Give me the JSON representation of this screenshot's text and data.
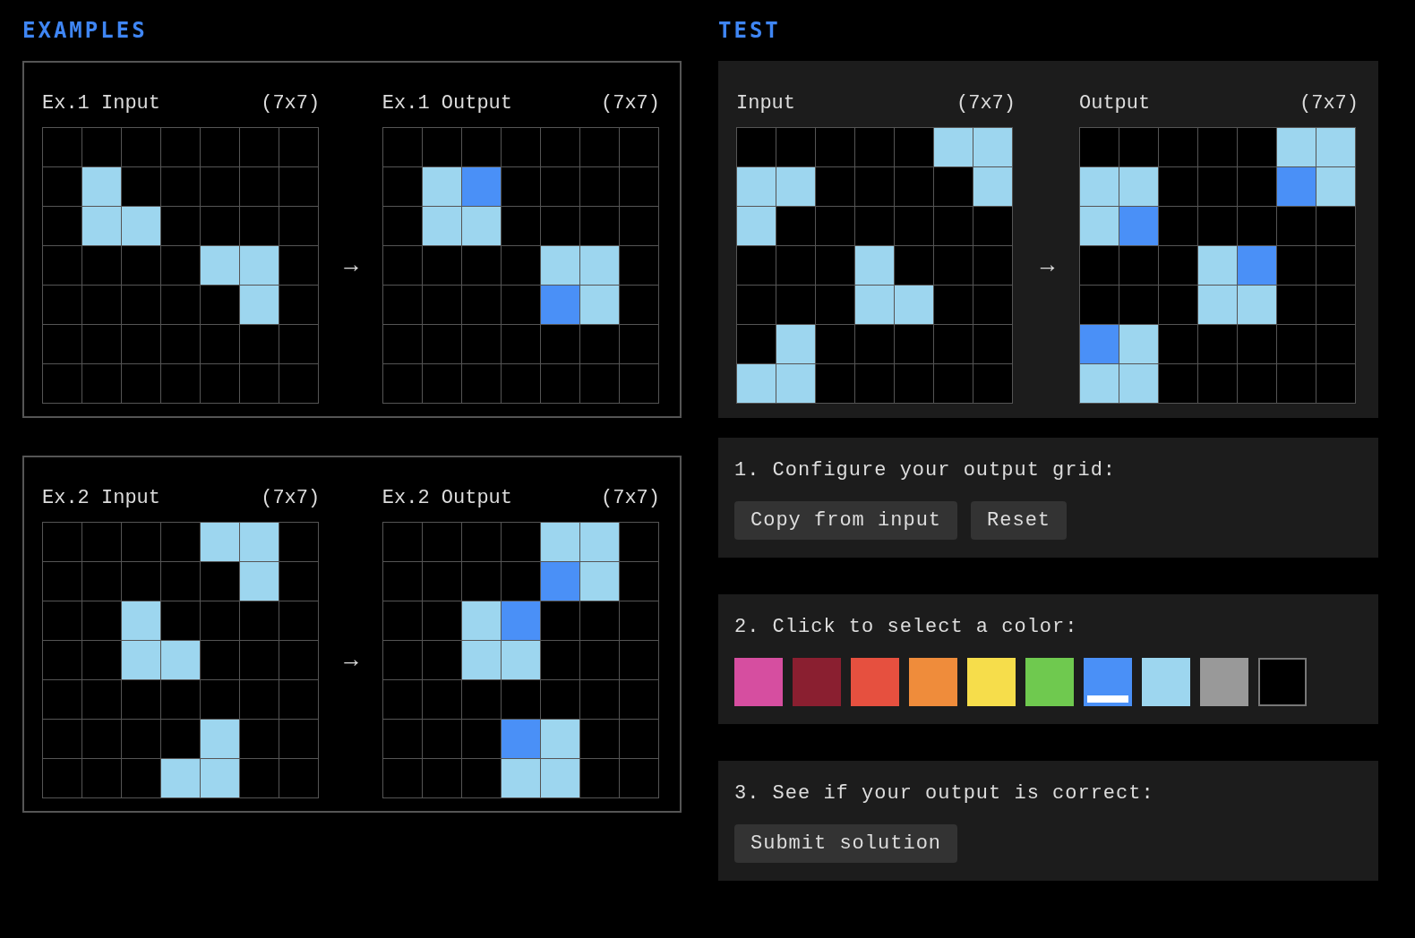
{
  "examples": {
    "heading": "EXAMPLES",
    "items": [
      {
        "input": {
          "label": "Ex.1 Input",
          "size": "(7x7)",
          "rows": [
            [
              {
                "color": "#000000"
              },
              {
                "color": "#000000"
              },
              {
                "color": "#000000"
              },
              {
                "color": "#000000"
              },
              {
                "color": "#000000"
              },
              {
                "color": "#000000"
              },
              {
                "color": "#000000"
              }
            ],
            [
              {
                "color": "#000000"
              },
              {
                "color": "#9dd6ef"
              },
              {
                "color": "#000000"
              },
              {
                "color": "#000000"
              },
              {
                "color": "#000000"
              },
              {
                "color": "#000000"
              },
              {
                "color": "#000000"
              }
            ],
            [
              {
                "color": "#000000"
              },
              {
                "color": "#9dd6ef"
              },
              {
                "color": "#9dd6ef"
              },
              {
                "color": "#000000"
              },
              {
                "color": "#000000"
              },
              {
                "color": "#000000"
              },
              {
                "color": "#000000"
              }
            ],
            [
              {
                "color": "#000000"
              },
              {
                "color": "#000000"
              },
              {
                "color": "#000000"
              },
              {
                "color": "#000000"
              },
              {
                "color": "#9dd6ef"
              },
              {
                "color": "#9dd6ef"
              },
              {
                "color": "#000000"
              }
            ],
            [
              {
                "color": "#000000"
              },
              {
                "color": "#000000"
              },
              {
                "color": "#000000"
              },
              {
                "color": "#000000"
              },
              {
                "color": "#000000"
              },
              {
                "color": "#9dd6ef"
              },
              {
                "color": "#000000"
              }
            ],
            [
              {
                "color": "#000000"
              },
              {
                "color": "#000000"
              },
              {
                "color": "#000000"
              },
              {
                "color": "#000000"
              },
              {
                "color": "#000000"
              },
              {
                "color": "#000000"
              },
              {
                "color": "#000000"
              }
            ],
            [
              {
                "color": "#000000"
              },
              {
                "color": "#000000"
              },
              {
                "color": "#000000"
              },
              {
                "color": "#000000"
              },
              {
                "color": "#000000"
              },
              {
                "color": "#000000"
              },
              {
                "color": "#000000"
              }
            ]
          ]
        },
        "arrow": "→",
        "output": {
          "label": "Ex.1 Output",
          "size": "(7x7)",
          "rows": [
            [
              {
                "color": "#000000"
              },
              {
                "color": "#000000"
              },
              {
                "color": "#000000"
              },
              {
                "color": "#000000"
              },
              {
                "color": "#000000"
              },
              {
                "color": "#000000"
              },
              {
                "color": "#000000"
              }
            ],
            [
              {
                "color": "#000000"
              },
              {
                "color": "#9dd6ef"
              },
              {
                "color": "#4a90f7"
              },
              {
                "color": "#000000"
              },
              {
                "color": "#000000"
              },
              {
                "color": "#000000"
              },
              {
                "color": "#000000"
              }
            ],
            [
              {
                "color": "#000000"
              },
              {
                "color": "#9dd6ef"
              },
              {
                "color": "#9dd6ef"
              },
              {
                "color": "#000000"
              },
              {
                "color": "#000000"
              },
              {
                "color": "#000000"
              },
              {
                "color": "#000000"
              }
            ],
            [
              {
                "color": "#000000"
              },
              {
                "color": "#000000"
              },
              {
                "color": "#000000"
              },
              {
                "color": "#000000"
              },
              {
                "color": "#9dd6ef"
              },
              {
                "color": "#9dd6ef"
              },
              {
                "color": "#000000"
              }
            ],
            [
              {
                "color": "#000000"
              },
              {
                "color": "#000000"
              },
              {
                "color": "#000000"
              },
              {
                "color": "#000000"
              },
              {
                "color": "#4a90f7"
              },
              {
                "color": "#9dd6ef"
              },
              {
                "color": "#000000"
              }
            ],
            [
              {
                "color": "#000000"
              },
              {
                "color": "#000000"
              },
              {
                "color": "#000000"
              },
              {
                "color": "#000000"
              },
              {
                "color": "#000000"
              },
              {
                "color": "#000000"
              },
              {
                "color": "#000000"
              }
            ],
            [
              {
                "color": "#000000"
              },
              {
                "color": "#000000"
              },
              {
                "color": "#000000"
              },
              {
                "color": "#000000"
              },
              {
                "color": "#000000"
              },
              {
                "color": "#000000"
              },
              {
                "color": "#000000"
              }
            ]
          ]
        }
      },
      {
        "input": {
          "label": "Ex.2 Input",
          "size": "(7x7)",
          "rows": [
            [
              {
                "color": "#000000"
              },
              {
                "color": "#000000"
              },
              {
                "color": "#000000"
              },
              {
                "color": "#000000"
              },
              {
                "color": "#9dd6ef"
              },
              {
                "color": "#9dd6ef"
              },
              {
                "color": "#000000"
              }
            ],
            [
              {
                "color": "#000000"
              },
              {
                "color": "#000000"
              },
              {
                "color": "#000000"
              },
              {
                "color": "#000000"
              },
              {
                "color": "#000000"
              },
              {
                "color": "#9dd6ef"
              },
              {
                "color": "#000000"
              }
            ],
            [
              {
                "color": "#000000"
              },
              {
                "color": "#000000"
              },
              {
                "color": "#9dd6ef"
              },
              {
                "color": "#000000"
              },
              {
                "color": "#000000"
              },
              {
                "color": "#000000"
              },
              {
                "color": "#000000"
              }
            ],
            [
              {
                "color": "#000000"
              },
              {
                "color": "#000000"
              },
              {
                "color": "#9dd6ef"
              },
              {
                "color": "#9dd6ef"
              },
              {
                "color": "#000000"
              },
              {
                "color": "#000000"
              },
              {
                "color": "#000000"
              }
            ],
            [
              {
                "color": "#000000"
              },
              {
                "color": "#000000"
              },
              {
                "color": "#000000"
              },
              {
                "color": "#000000"
              },
              {
                "color": "#000000"
              },
              {
                "color": "#000000"
              },
              {
                "color": "#000000"
              }
            ],
            [
              {
                "color": "#000000"
              },
              {
                "color": "#000000"
              },
              {
                "color": "#000000"
              },
              {
                "color": "#000000"
              },
              {
                "color": "#9dd6ef"
              },
              {
                "color": "#000000"
              },
              {
                "color": "#000000"
              }
            ],
            [
              {
                "color": "#000000"
              },
              {
                "color": "#000000"
              },
              {
                "color": "#000000"
              },
              {
                "color": "#9dd6ef"
              },
              {
                "color": "#9dd6ef"
              },
              {
                "color": "#000000"
              },
              {
                "color": "#000000"
              }
            ]
          ]
        },
        "arrow": "→",
        "output": {
          "label": "Ex.2 Output",
          "size": "(7x7)",
          "rows": [
            [
              {
                "color": "#000000"
              },
              {
                "color": "#000000"
              },
              {
                "color": "#000000"
              },
              {
                "color": "#000000"
              },
              {
                "color": "#9dd6ef"
              },
              {
                "color": "#9dd6ef"
              },
              {
                "color": "#000000"
              }
            ],
            [
              {
                "color": "#000000"
              },
              {
                "color": "#000000"
              },
              {
                "color": "#000000"
              },
              {
                "color": "#000000"
              },
              {
                "color": "#4a90f7"
              },
              {
                "color": "#9dd6ef"
              },
              {
                "color": "#000000"
              }
            ],
            [
              {
                "color": "#000000"
              },
              {
                "color": "#000000"
              },
              {
                "color": "#9dd6ef"
              },
              {
                "color": "#4a90f7"
              },
              {
                "color": "#000000"
              },
              {
                "color": "#000000"
              },
              {
                "color": "#000000"
              }
            ],
            [
              {
                "color": "#000000"
              },
              {
                "color": "#000000"
              },
              {
                "color": "#9dd6ef"
              },
              {
                "color": "#9dd6ef"
              },
              {
                "color": "#000000"
              },
              {
                "color": "#000000"
              },
              {
                "color": "#000000"
              }
            ],
            [
              {
                "color": "#000000"
              },
              {
                "color": "#000000"
              },
              {
                "color": "#000000"
              },
              {
                "color": "#000000"
              },
              {
                "color": "#000000"
              },
              {
                "color": "#000000"
              },
              {
                "color": "#000000"
              }
            ],
            [
              {
                "color": "#000000"
              },
              {
                "color": "#000000"
              },
              {
                "color": "#000000"
              },
              {
                "color": "#4a90f7"
              },
              {
                "color": "#9dd6ef"
              },
              {
                "color": "#000000"
              },
              {
                "color": "#000000"
              }
            ],
            [
              {
                "color": "#000000"
              },
              {
                "color": "#000000"
              },
              {
                "color": "#000000"
              },
              {
                "color": "#9dd6ef"
              },
              {
                "color": "#9dd6ef"
              },
              {
                "color": "#000000"
              },
              {
                "color": "#000000"
              }
            ]
          ]
        }
      }
    ]
  },
  "test": {
    "heading": "TEST",
    "input": {
      "label": "Input",
      "size": "(7x7)",
      "rows": [
        [
          {
            "color": "#000000"
          },
          {
            "color": "#000000"
          },
          {
            "color": "#000000"
          },
          {
            "color": "#000000"
          },
          {
            "color": "#000000"
          },
          {
            "color": "#9dd6ef"
          },
          {
            "color": "#9dd6ef"
          }
        ],
        [
          {
            "color": "#9dd6ef"
          },
          {
            "color": "#9dd6ef"
          },
          {
            "color": "#000000"
          },
          {
            "color": "#000000"
          },
          {
            "color": "#000000"
          },
          {
            "color": "#000000"
          },
          {
            "color": "#9dd6ef"
          }
        ],
        [
          {
            "color": "#9dd6ef"
          },
          {
            "color": "#000000"
          },
          {
            "color": "#000000"
          },
          {
            "color": "#000000"
          },
          {
            "color": "#000000"
          },
          {
            "color": "#000000"
          },
          {
            "color": "#000000"
          }
        ],
        [
          {
            "color": "#000000"
          },
          {
            "color": "#000000"
          },
          {
            "color": "#000000"
          },
          {
            "color": "#9dd6ef"
          },
          {
            "color": "#000000"
          },
          {
            "color": "#000000"
          },
          {
            "color": "#000000"
          }
        ],
        [
          {
            "color": "#000000"
          },
          {
            "color": "#000000"
          },
          {
            "color": "#000000"
          },
          {
            "color": "#9dd6ef"
          },
          {
            "color": "#9dd6ef"
          },
          {
            "color": "#000000"
          },
          {
            "color": "#000000"
          }
        ],
        [
          {
            "color": "#000000"
          },
          {
            "color": "#9dd6ef"
          },
          {
            "color": "#000000"
          },
          {
            "color": "#000000"
          },
          {
            "color": "#000000"
          },
          {
            "color": "#000000"
          },
          {
            "color": "#000000"
          }
        ],
        [
          {
            "color": "#9dd6ef"
          },
          {
            "color": "#9dd6ef"
          },
          {
            "color": "#000000"
          },
          {
            "color": "#000000"
          },
          {
            "color": "#000000"
          },
          {
            "color": "#000000"
          },
          {
            "color": "#000000"
          }
        ]
      ]
    },
    "arrow": "→",
    "output": {
      "label": "Output",
      "size": "(7x7)",
      "rows": [
        [
          {
            "color": "#000000"
          },
          {
            "color": "#000000"
          },
          {
            "color": "#000000"
          },
          {
            "color": "#000000"
          },
          {
            "color": "#000000"
          },
          {
            "color": "#9dd6ef"
          },
          {
            "color": "#9dd6ef"
          }
        ],
        [
          {
            "color": "#9dd6ef"
          },
          {
            "color": "#9dd6ef"
          },
          {
            "color": "#000000"
          },
          {
            "color": "#000000"
          },
          {
            "color": "#000000"
          },
          {
            "color": "#4a90f7"
          },
          {
            "color": "#9dd6ef"
          }
        ],
        [
          {
            "color": "#9dd6ef"
          },
          {
            "color": "#4a90f7"
          },
          {
            "color": "#000000"
          },
          {
            "color": "#000000"
          },
          {
            "color": "#000000"
          },
          {
            "color": "#000000"
          },
          {
            "color": "#000000"
          }
        ],
        [
          {
            "color": "#000000"
          },
          {
            "color": "#000000"
          },
          {
            "color": "#000000"
          },
          {
            "color": "#9dd6ef"
          },
          {
            "color": "#4a90f7"
          },
          {
            "color": "#000000"
          },
          {
            "color": "#000000"
          }
        ],
        [
          {
            "color": "#000000"
          },
          {
            "color": "#000000"
          },
          {
            "color": "#000000"
          },
          {
            "color": "#9dd6ef"
          },
          {
            "color": "#9dd6ef"
          },
          {
            "color": "#000000"
          },
          {
            "color": "#000000"
          }
        ],
        [
          {
            "color": "#4a90f7"
          },
          {
            "color": "#9dd6ef"
          },
          {
            "color": "#000000"
          },
          {
            "color": "#000000"
          },
          {
            "color": "#000000"
          },
          {
            "color": "#000000"
          },
          {
            "color": "#000000"
          }
        ],
        [
          {
            "color": "#9dd6ef"
          },
          {
            "color": "#9dd6ef"
          },
          {
            "color": "#000000"
          },
          {
            "color": "#000000"
          },
          {
            "color": "#000000"
          },
          {
            "color": "#000000"
          },
          {
            "color": "#000000"
          }
        ]
      ]
    },
    "steps": [
      {
        "kind": "buttons",
        "title": "1. Configure your output grid:",
        "buttons": [
          "Copy from input",
          "Reset"
        ]
      },
      {
        "kind": "palette",
        "title": "2. Click to select a color:",
        "palette": [
          {
            "color": "#d64ea0",
            "selected": false
          },
          {
            "color": "#8a1f30",
            "selected": false
          },
          {
            "color": "#e6503f",
            "selected": false
          },
          {
            "color": "#ef8c3b",
            "selected": false
          },
          {
            "color": "#f6dd4b",
            "selected": false
          },
          {
            "color": "#6fc94f",
            "selected": false
          },
          {
            "color": "#4a90f7",
            "selected": true
          },
          {
            "color": "#9dd6ef",
            "selected": false
          },
          {
            "color": "#999999",
            "selected": false
          },
          {
            "color": "#000000",
            "selected": false
          }
        ]
      },
      {
        "kind": "buttons",
        "title": "3. See if your output is correct:",
        "buttons": [
          "Submit solution"
        ]
      }
    ]
  }
}
